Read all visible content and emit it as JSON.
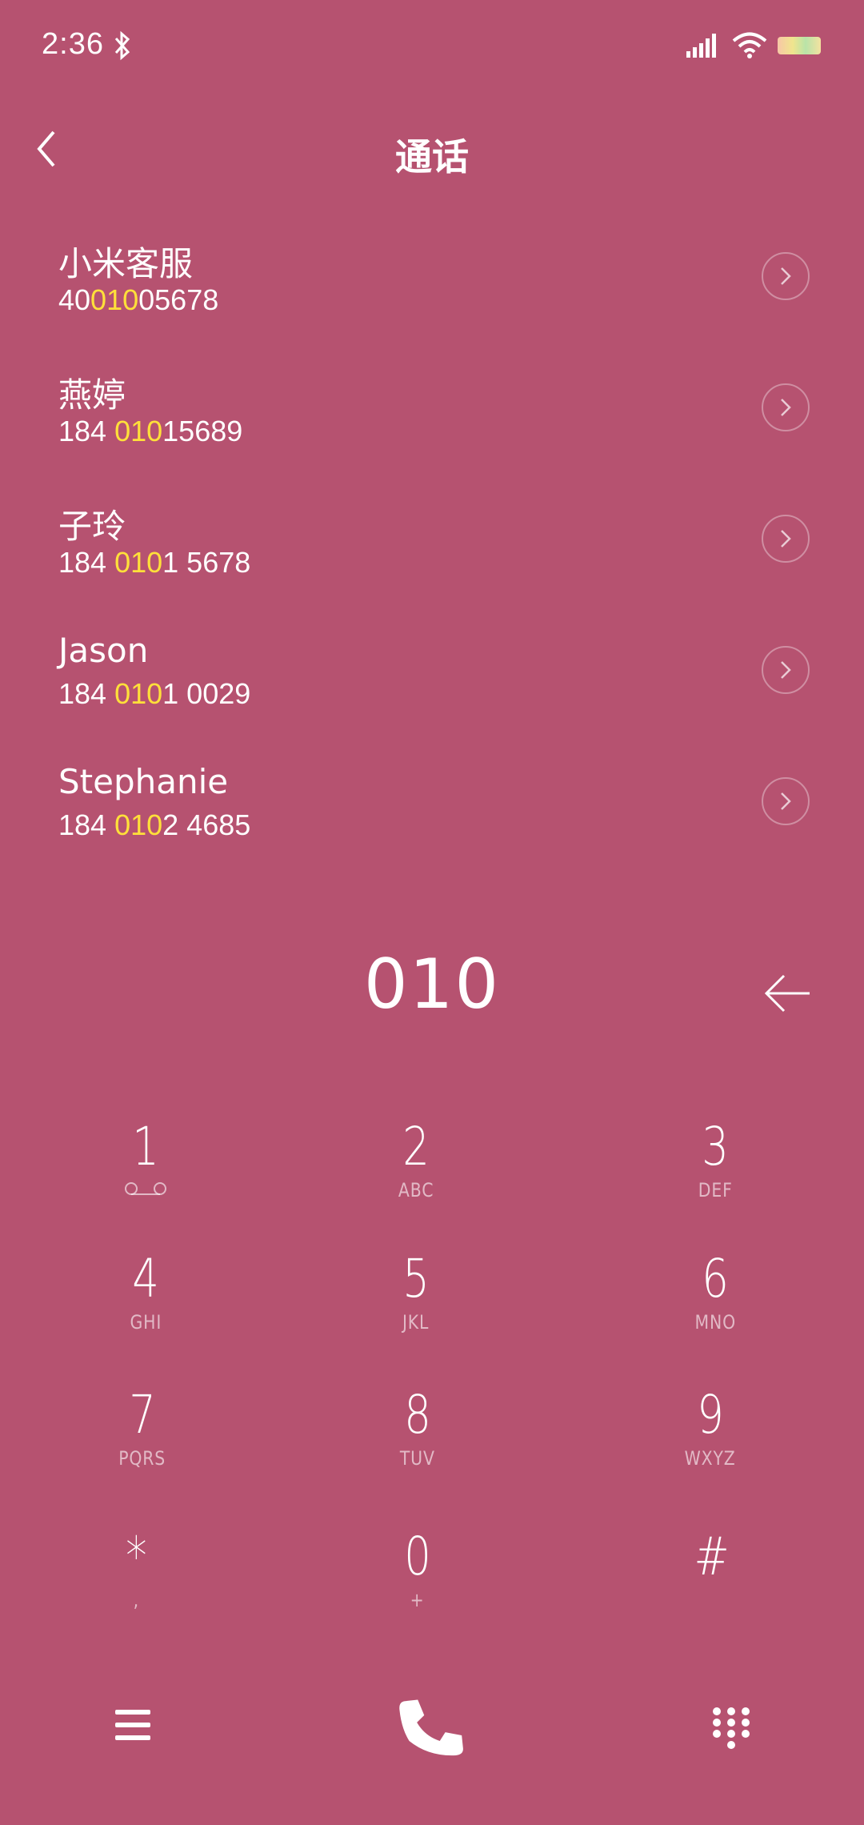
{
  "status": {
    "time": "2:36",
    "icons": [
      "bluetooth-icon",
      "signal-icon",
      "wifi-icon",
      "battery-icon"
    ]
  },
  "header": {
    "title": "通话",
    "back_icon": "chevron-left-icon"
  },
  "contacts": [
    {
      "name": "小米客服",
      "number_pre": "40",
      "number_match": "010",
      "number_post": "05678"
    },
    {
      "name": "燕婷",
      "number_pre": "184 ",
      "number_match": "010",
      "number_post": "15689"
    },
    {
      "name": "子玲",
      "number_pre": "184 ",
      "number_match": "010",
      "number_post": "1 5678"
    },
    {
      "name": "Jason",
      "number_pre": "184 ",
      "number_match": "010",
      "number_post": "1 0029"
    },
    {
      "name": "Stephanie",
      "number_pre": "184 ",
      "number_match": "010",
      "number_post": "2 4685"
    }
  ],
  "dial": {
    "input": "010"
  },
  "keypad": [
    {
      "digit": "1",
      "letters": ""
    },
    {
      "digit": "2",
      "letters": "ABC"
    },
    {
      "digit": "3",
      "letters": "DEF"
    },
    {
      "digit": "4",
      "letters": "GHI"
    },
    {
      "digit": "5",
      "letters": "JKL"
    },
    {
      "digit": "6",
      "letters": "MNO"
    },
    {
      "digit": "7",
      "letters": "PQRS"
    },
    {
      "digit": "8",
      "letters": "TUV"
    },
    {
      "digit": "9",
      "letters": "WXYZ"
    },
    {
      "digit": "*",
      "letters": ","
    },
    {
      "digit": "0",
      "letters": "+"
    },
    {
      "digit": "#",
      "letters": ""
    }
  ],
  "colors": {
    "background": "#b65270",
    "highlight": "#ffe03a",
    "text": "#ffffff"
  }
}
